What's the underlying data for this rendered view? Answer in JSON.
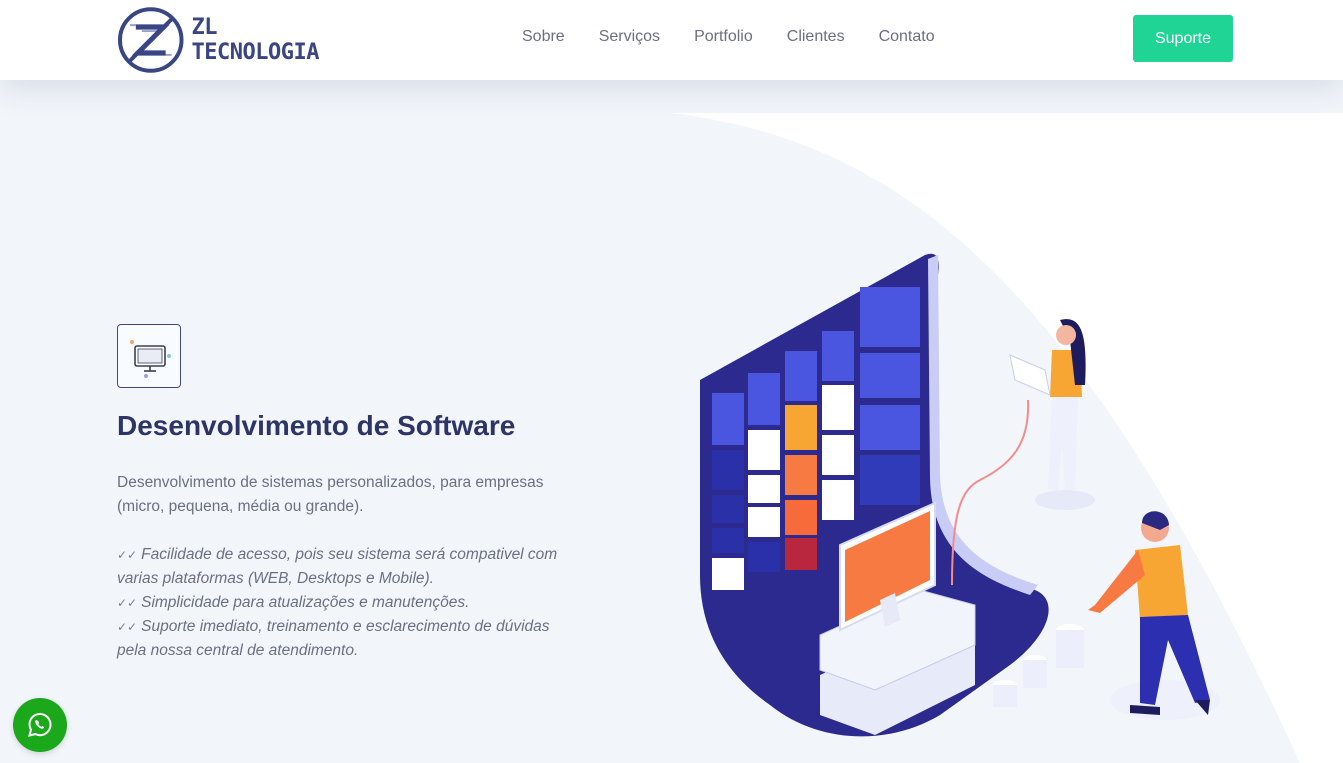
{
  "header": {
    "logo_text": "ZL TECNOLOGIA",
    "nav": [
      "Sobre",
      "Serviços",
      "Portfolio",
      "Clientes",
      "Contato"
    ],
    "support_label": "Suporte"
  },
  "service": {
    "icon": "monitor-icon",
    "title": "Desenvolvimento de Software",
    "description": "Desenvolvimento de sistemas personalizados, para empresas (micro, pequena, média ou grande).",
    "features": [
      "Facilidade de acesso, pois seu sistema será compativel com varias plataformas (WEB, Desktops e Mobile).",
      "Simplicidade para atualizações e manutenções.",
      "Suporte imediato, treinamento e esclarecimento de dúvidas pela nossa central de atendimento."
    ]
  },
  "colors": {
    "accent": "#1fd494",
    "primary": "#2d3566",
    "whatsapp": "#1ba81b"
  },
  "floating": {
    "whatsapp_icon": "whatsapp-icon"
  }
}
